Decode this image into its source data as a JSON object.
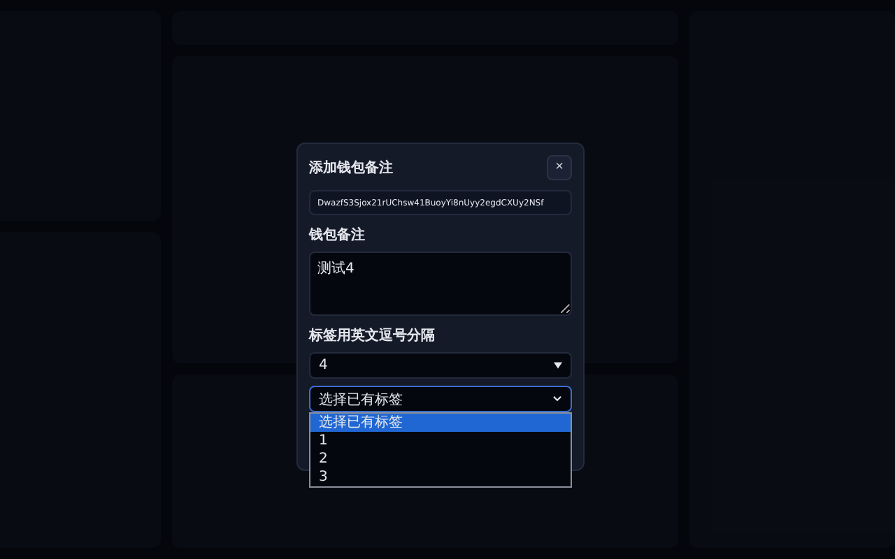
{
  "modal": {
    "title": "添加钱包备注",
    "close": "×",
    "address": {
      "value": "DwazfS3Sjox21rUChsw41BuoyYi8nUyy2egdCXUy2NSf"
    },
    "note": {
      "label": "钱包备注",
      "value": "测试4"
    },
    "tags": {
      "label": "标签用英文逗号分隔",
      "value": "4"
    },
    "tag_select": {
      "value": "选择已有标签",
      "expanded": true,
      "options": [
        {
          "label": "选择已有标签",
          "selected": true
        },
        {
          "label": "1",
          "selected": false
        },
        {
          "label": "2",
          "selected": false
        },
        {
          "label": "3",
          "selected": false
        }
      ]
    }
  }
}
